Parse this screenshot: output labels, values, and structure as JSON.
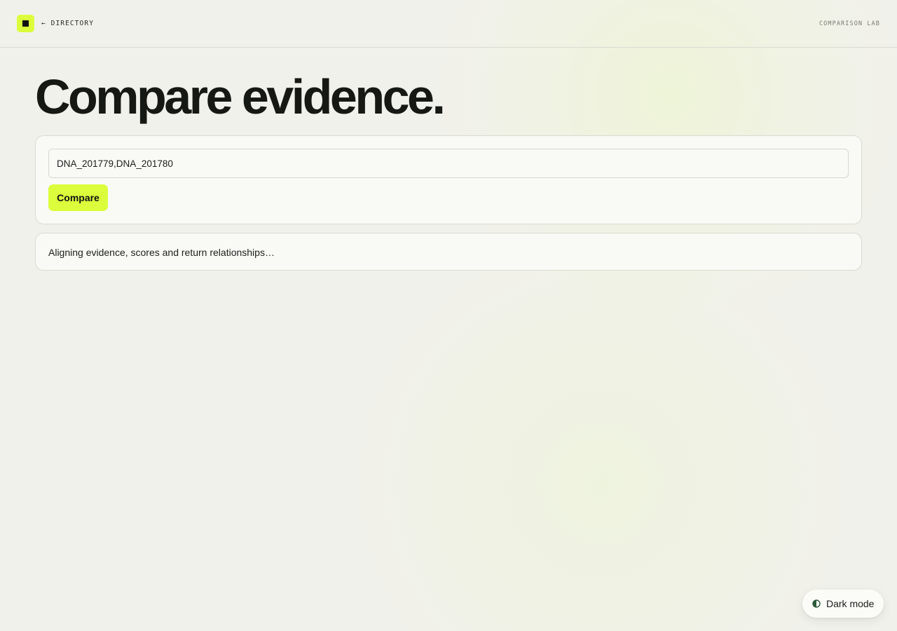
{
  "header": {
    "back_link": "← DIRECTORY",
    "section_label": "COMPARISON LAB",
    "logo_icon": "square-icon"
  },
  "main": {
    "title": "Compare evidence.",
    "form": {
      "input_value": "DNA_201779,DNA_201780",
      "compare_label": "Compare"
    },
    "status": {
      "text": "Aligning evidence, scores and return relationships…"
    }
  },
  "theme_toggle": {
    "label": "Dark mode",
    "icon": "contrast-icon"
  },
  "colors": {
    "accent": "#dcfd3c",
    "background": "#f1f1eb",
    "card": "#f9faf5",
    "text": "#161814"
  }
}
